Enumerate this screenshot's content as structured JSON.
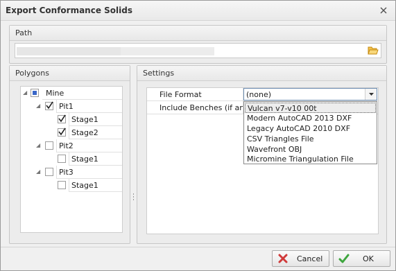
{
  "window": {
    "title": "Export Conformance Solids",
    "close_icon": "close-icon"
  },
  "path": {
    "group_label": "Path",
    "value": "",
    "browse_icon": "folder-open-icon"
  },
  "polygons": {
    "group_label": "Polygons",
    "tree": {
      "root": {
        "label": "Mine",
        "state": "indeterminate"
      },
      "items": [
        {
          "label": "Pit1",
          "checked": true
        },
        {
          "label": "Stage1",
          "checked": true
        },
        {
          "label": "Stage2",
          "checked": true
        },
        {
          "label": "Pit2",
          "checked": false
        },
        {
          "label": "Stage1",
          "checked": false
        },
        {
          "label": "Pit3",
          "checked": false
        },
        {
          "label": "Stage1",
          "checked": false
        }
      ]
    }
  },
  "settings": {
    "group_label": "Settings",
    "properties": [
      {
        "name": "File Format",
        "value": "(none)"
      },
      {
        "name": "Include Benches (if any)",
        "value": ""
      }
    ],
    "file_format_options": [
      "Vulcan v7-v10 00t",
      "Modern AutoCAD 2013 DXF",
      "Legacy AutoCAD 2010 DXF",
      "CSV Triangles File",
      "Wavefront OBJ",
      "Micromine Triangulation File"
    ],
    "highlighted_option": "Vulcan v7-v10 00t"
  },
  "buttons": {
    "cancel": "Cancel",
    "ok": "OK"
  },
  "colors": {
    "cancel_icon": "#d03a3a",
    "ok_icon": "#3da53d",
    "folder_icon": "#e8a415"
  }
}
